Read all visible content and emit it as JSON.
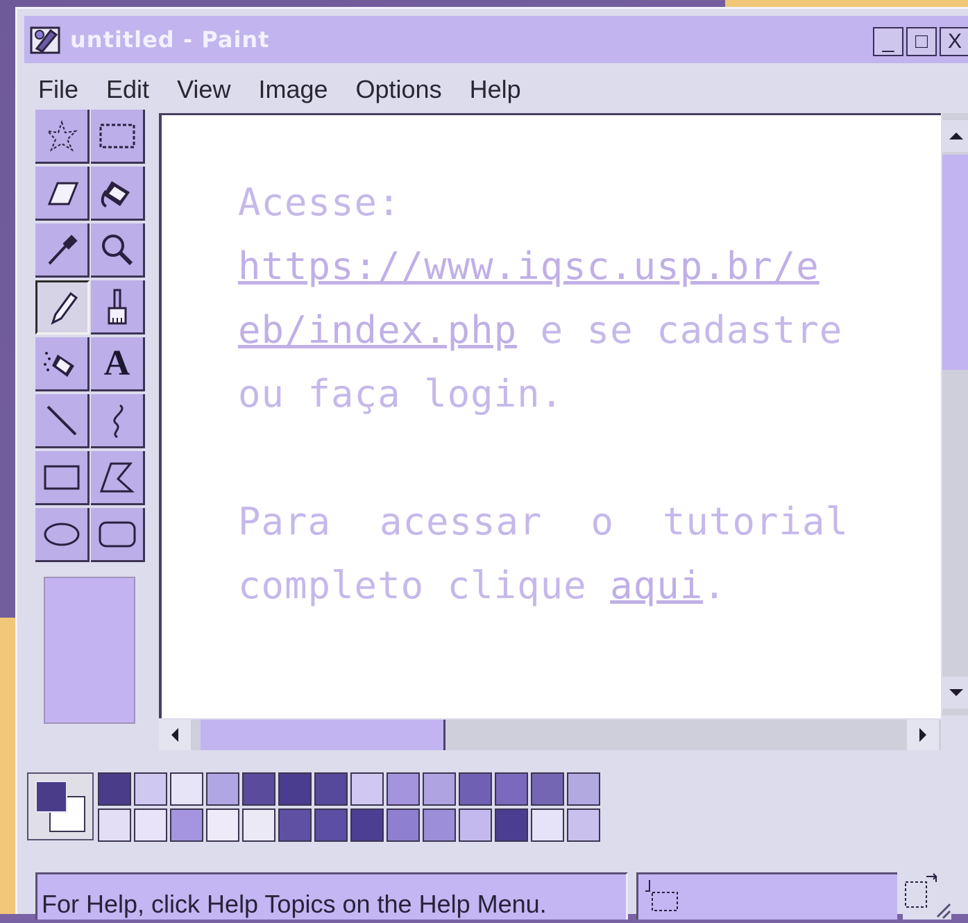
{
  "window": {
    "title": "untitled - Paint",
    "minimize": "_",
    "maximize": "□",
    "close": "X"
  },
  "menu": {
    "file": "File",
    "edit": "Edit",
    "view": "View",
    "image": "Image",
    "options": "Options",
    "help": "Help"
  },
  "tools": [
    "free-form-select-icon",
    "select-icon",
    "eraser-icon",
    "fill-icon",
    "pick-color-icon",
    "magnifier-icon",
    "pencil-icon",
    "brush-icon",
    "airbrush-icon",
    "text-icon",
    "line-icon",
    "curve-icon",
    "rectangle-icon",
    "polygon-icon",
    "ellipse-icon",
    "rounded-rectangle-icon"
  ],
  "canvas": {
    "line1": "Acesse:",
    "link1a": "https://www.iqsc.usp.br/e",
    "link1b": "eb/index.php",
    "line3_rest": " e se cadastre",
    "line4": "ou faça login.",
    "para_w1": "Para",
    "para_w2": "acessar",
    "para_w3": "o",
    "para_w4": "tutorial",
    "line6_pre": "completo clique ",
    "link2": "aqui",
    "line6_end": "."
  },
  "palette": {
    "top": [
      "#4b3c8a",
      "#cfc8f0",
      "#e8e4f8",
      "#b0a6e3",
      "#5a4b9c",
      "#4a3c8e",
      "#56489a",
      "#d0c8f2",
      "#a493dd",
      "#b0a3e2",
      "#7060b4",
      "#7a69bd",
      "#7566b4",
      "#b2a9e0"
    ],
    "bottom": [
      "#e3def6",
      "#e8e3f8",
      "#a595e0",
      "#eeeaf9",
      "#ece9f7",
      "#5f50a4",
      "#5c4ea3",
      "#4c3e93",
      "#8f7fd1",
      "#9d8ed9",
      "#c4b9ee",
      "#4b3e90",
      "#e6e2f7",
      "#c9c0ee"
    ],
    "foreground": "#4b3c8a",
    "background": "#ffffff"
  },
  "status": {
    "text": "For Help, click Help Topics on the Help Menu."
  }
}
